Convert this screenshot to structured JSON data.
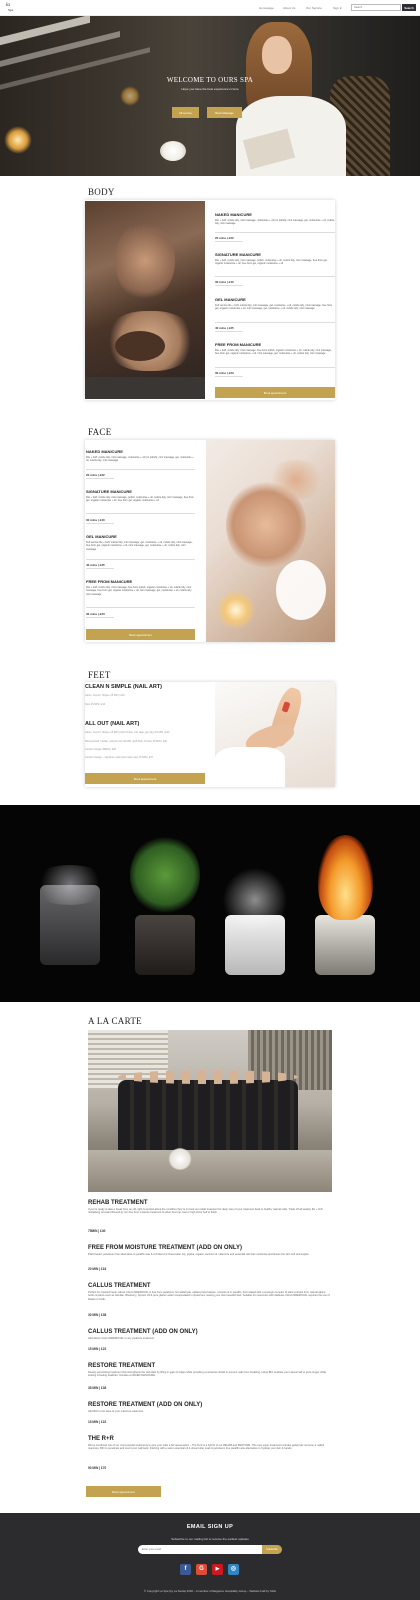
{
  "nav": {
    "logo_line1": "la",
    "logo_line2": "Spa",
    "links": [
      "Homepage",
      "About Us",
      "Our Service",
      "Sign in"
    ],
    "search_placeholder": "Search",
    "search_button": "Search"
  },
  "hero": {
    "title": "WELCOME TO OURS SPA",
    "subtitle": "Hope you have the best experience in here",
    "btn_all_service": "All service",
    "btn_book": "Book Massage"
  },
  "body_section": {
    "title": "BODY",
    "items": [
      {
        "name": "NAKED MANICURE",
        "desc": "File + buff, cuticle tidy, mini massage, moisturise + oil (no polish), mini massage, gel, moisturise + oil, cuticle tidy, mini massage",
        "price": "20 mins | £22"
      },
      {
        "name": "SIGNATURE MANICURE",
        "desc": "File + buff, cuticle tidy, mini massage, polish, moisturise + oil, cuticle tidy, mini massage, free from gel, organic moisturise + oil, free from gel, organic moisturise + oil",
        "price": "30 mins | £40"
      },
      {
        "name": "GEL MANICURE",
        "desc": "Full service file + buff, cuticle tidy, mini massage, gel, moisturise + oil, cuticle tidy, mini massage, free from gel, organic moisturise + oil, mini massage, gel, moisturise + oil, cuticle tidy, mini massage",
        "price": "40 mins | £35"
      },
      {
        "name": "FREE FROM MANICURE",
        "desc": "File + buff, cuticle tidy, mini massage, free from polish, organic moisturise + oil, cuticle tidy, mini massage, free from gel, organic moisturise + oil, mini massage, gel, moisturise + oil, cuticle tidy, mini massage",
        "price": "30 mins | £23"
      }
    ],
    "book_button": "Book appointment"
  },
  "face_section": {
    "title": "FACE",
    "items": [
      {
        "name": "NAKED MANICURE",
        "desc": "File + buff, cuticle tidy, mini massage, moisturise + oil (no polish), mini massage, gel, moisturise + oil, cuticle tidy, mini massage",
        "price": "20 mins | £22"
      },
      {
        "name": "SIGNATURE MANICURE",
        "desc": "File + buff, cuticle tidy, mini massage, polish, moisturise + oil, cuticle tidy, mini massage, free from gel, organic moisturise + oil, free from gel, organic moisturise + oil",
        "price": "30 mins | £40"
      },
      {
        "name": "GEL MANICURE",
        "desc": "Full service file + buff, cuticle tidy, mini massage, gel, moisturise + oil, cuticle tidy, mini massage, free from gel, organic moisturise + oil, mini massage, gel, moisturise + oil, cuticle tidy, mini massage",
        "price": "40 mins | £35"
      },
      {
        "name": "FREE FROM MANICURE",
        "desc": "File + buff, cuticle tidy, mini massage, free from polish, organic moisturise + oil, cuticle tidy, mini massage, free from gel, organic moisturise + oil, mini massage, gel, moisturise + oil, cuticle tidy, mini massage",
        "price": "30 mins | £23"
      }
    ],
    "book_button": "Book appointment"
  },
  "feet_section": {
    "title": "FEET",
    "group1_title": "CLEAN N SIMPLE (NAIL ART)",
    "group1_lines": [
      "Gloss, French, Stripes 15 MIN | £10",
      "Dots 15 MIN | £10"
    ],
    "group2_title": "ALL OUT (NAIL ART)",
    "group2_lines": [
      "Gloss, French, Stripes 15 MIN | £10 Ombre, foil, tape, gel (dry) 15 MIN | £20",
      "Rhinestone8, marble, animal print 20 MIN | £25 Pink, Ombre 25 MIN | £30",
      "Custom design 30MIN | £35",
      "Custom design – signature nails (two nails max) 15 MIN | £37"
    ],
    "book_button": "Book appointment"
  },
  "alacarte": {
    "title": "A LA CARTE",
    "items": [
      {
        "name": "REHAB TREATMENT",
        "desc": "If you’re ready to take a break from an old, tight & worried about the condition they’re in book our rehab treatment for deep care of your treatment back to healthy natural nails. Trade off all weekly, file + buff, revitalising oil soak followed by our free from moisture treatment & either best top coat or high shine buff to finish.",
        "price": "75MIN | £40"
      },
      {
        "name": "FREE FROM MOISTURE TREATMENT (ADD ON ONLY)",
        "desc": "Plant based, petroleum free alternative to paraffin wax & rich blend of shea butter soy, jojoba, organic coconut oil, vitamin E and essential oils that moisturise and leaves the skin soft and supple.",
        "price": "20 MIN | £16"
      },
      {
        "name": "CALLUS TREATMENT",
        "desc": "Perfect for cracked heels, Aduso CALLUSREMOVAL is free from parabens, formaldehyde, added preservatives, mineral oil or paraffin. Formulated with a synergic complex of plant extracts from natural alpine herbs & plants such as Gentian, Blueberry, Spruce Oil & pure glacier water encapsulated in liposomes, leaving your skin beautiful feel. Suitable for customers with diabetes CALLUSREMOVAL requires the use of blades or knife.",
        "price": "30 MIN | £38"
      },
      {
        "name": "CALLUS TREATMENT (ADD ON ONLY)",
        "desc": "Add Aduso CALLUSREMOVAL to any pedicure treatment.",
        "price": "15 MIN | £22"
      },
      {
        "name": "RESTORE TREATMENT",
        "desc": "Deeply penetrating treatment that strengthens the nail plate by filling in gaps & ridges while providing a protective shield to prevent nails from breaking. Using BIO enables your natural nail to grow longer while looking & feeling healthier. Includes a NAKED MANICURE.",
        "price": "35 MIN | £38"
      },
      {
        "name": "RESTORE TREATMENT (ADD ON ONLY)",
        "desc": "Add BIO to the base of your manicure treatment.",
        "price": "15 MIN | £22"
      },
      {
        "name": "THE R+R",
        "desc": "We’ve combined two of our most popular treatments to give your nails a full rejuvenation – The R+R is a hybrid of our REHAB and RESTORE. This new super treatment includes gel/acrylic removal, a naked manicure, BIO to penetrate and mend your nail beds, finishing with a warm essential oil & shea butter soak & petroleum free paraffin wax alternative to hydrate your skin & hands.",
        "price": "90 MIN | £70"
      }
    ],
    "book_button": "Book appointment"
  },
  "footer": {
    "title": "EMAIL SIGN UP",
    "subtitle": "Subscribe to our mailing list to receive the earliest updates",
    "email_placeholder": "Enter your email",
    "subscribe_button": "Subscribe",
    "social": [
      "f",
      "G",
      "▶",
      "◎"
    ],
    "social_colors": [
      "#3b5998",
      "#dd4b39",
      "#cc181e",
      "#2d87c7"
    ],
    "copyright": "© Copyright La Spa (by La Sesta) 2018 – A member of Elegance Hospitality Group – Website built by SHG"
  }
}
